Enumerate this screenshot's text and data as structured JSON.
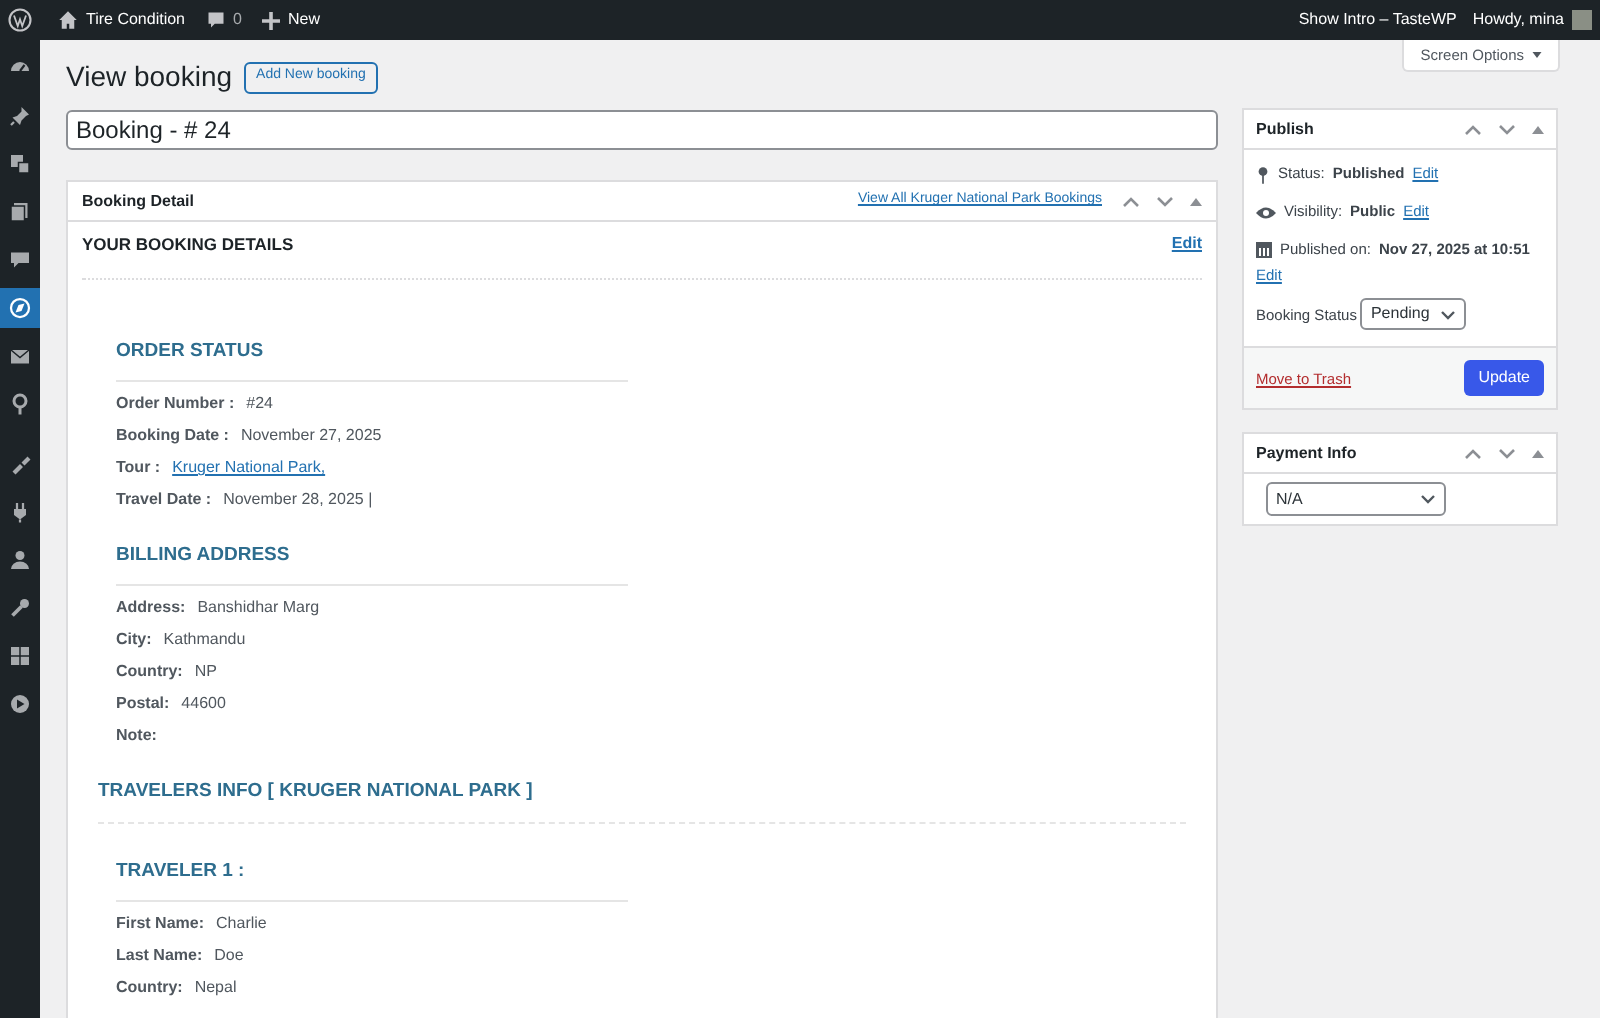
{
  "admin_bar": {
    "site": "Tire Condition",
    "comments": "0",
    "new": "New",
    "intro": "Show Intro – TasteWP",
    "greeting": "Howdy, mina"
  },
  "sidebar": {
    "items": [
      {
        "selected": false
      },
      {
        "selected": false
      },
      {
        "selected": false
      },
      {
        "selected": false
      },
      {
        "selected": false
      },
      {
        "selected": true
      },
      {
        "selected": false
      },
      {
        "selected": false
      },
      {
        "selected": false
      },
      {
        "selected": false
      },
      {
        "selected": false
      },
      {
        "selected": false
      },
      {
        "selected": false
      },
      {
        "selected": false
      }
    ]
  },
  "screen_options": "Screen Options",
  "page_title": "View booking",
  "add_new": "Add New booking",
  "title_value": "Booking - # 24",
  "booking_detail": {
    "title": "Booking Detail",
    "view_all": "View All Kruger National Park Bookings",
    "heading": "YOUR BOOKING DETAILS",
    "edit": "Edit",
    "sections": [
      {
        "title": "ORDER STATUS",
        "rows": [
          {
            "label": "Order Number :",
            "value": "#24",
            "kind": "text"
          },
          {
            "label": "Booking Date :",
            "value": "November 27, 2025",
            "kind": "text"
          },
          {
            "label": "Tour :",
            "value": "Kruger National Park,",
            "kind": "link"
          },
          {
            "label": "Travel Date :",
            "value": "November 28, 2025 |",
            "kind": "text"
          }
        ]
      },
      {
        "title": "BILLING ADDRESS",
        "rows": [
          {
            "label": "Address:",
            "value": "Banshidhar Marg",
            "kind": "text"
          },
          {
            "label": "City:",
            "value": "Kathmandu",
            "kind": "text"
          },
          {
            "label": "Country:",
            "value": "NP",
            "kind": "text"
          },
          {
            "label": "Postal:",
            "value": "44600",
            "kind": "text"
          },
          {
            "label": "Note:",
            "value": "",
            "kind": "text"
          }
        ]
      }
    ],
    "travelers_title": "TRAVELERS INFO [ KRUGER NATIONAL PARK ]",
    "travelers": [
      {
        "title": "TRAVELER 1 :",
        "rows": [
          {
            "label": "First Name:",
            "value": "Charlie",
            "kind": "text"
          },
          {
            "label": "Last Name:",
            "value": "Doe",
            "kind": "text"
          },
          {
            "label": "Country:",
            "value": "Nepal",
            "kind": "text"
          }
        ]
      }
    ]
  },
  "publish": {
    "title": "Publish",
    "status_label": "Status:",
    "status": "Published",
    "visibility_label": "Visibility:",
    "visibility": "Public",
    "published_label": "Published on:",
    "published": "Nov 27, 2025 at 10:51",
    "status_edit": "Edit",
    "visibility_edit": "Edit",
    "date_edit": "Edit",
    "booking_status_label": "Booking Status",
    "booking_status": "Pending",
    "trash": "Move to Trash",
    "update": "Update"
  },
  "payment_info": {
    "title": "Payment Info",
    "value": "N/A"
  }
}
